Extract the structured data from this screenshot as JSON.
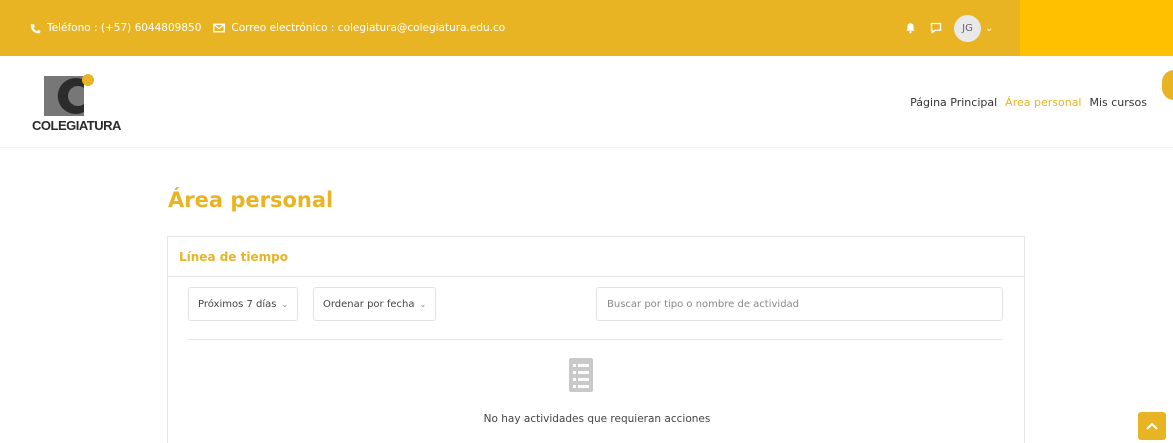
{
  "topbar": {
    "phone": "Teléfono : (+57) 6044809850",
    "email": "Correo electrónico : colegiatura@colegiatura.edu.co",
    "avatar_initials": "JG",
    "caret": "⌄"
  },
  "logo": {
    "wordmark": "COLEGIATURA"
  },
  "nav": {
    "items": [
      {
        "label": "Página Principal"
      },
      {
        "label": "Área personal"
      },
      {
        "label": "Mis cursos"
      }
    ]
  },
  "main": {
    "title": "Área personal",
    "timeline": {
      "heading": "Línea de tiempo",
      "filter_label": "Próximos 7 días",
      "sort_label": "Ordenar por fecha",
      "search_placeholder": "Buscar por tipo o nombre de actividad",
      "empty_message": "No hay actividades que requieran acciones"
    }
  },
  "colors": {
    "brand_yellow": "#e8b423",
    "highlight_yellow": "#ffc000"
  },
  "icons": [
    "phone-icon",
    "mail-icon",
    "bell-icon",
    "chat-icon",
    "list-icon",
    "chevron-up-icon"
  ]
}
